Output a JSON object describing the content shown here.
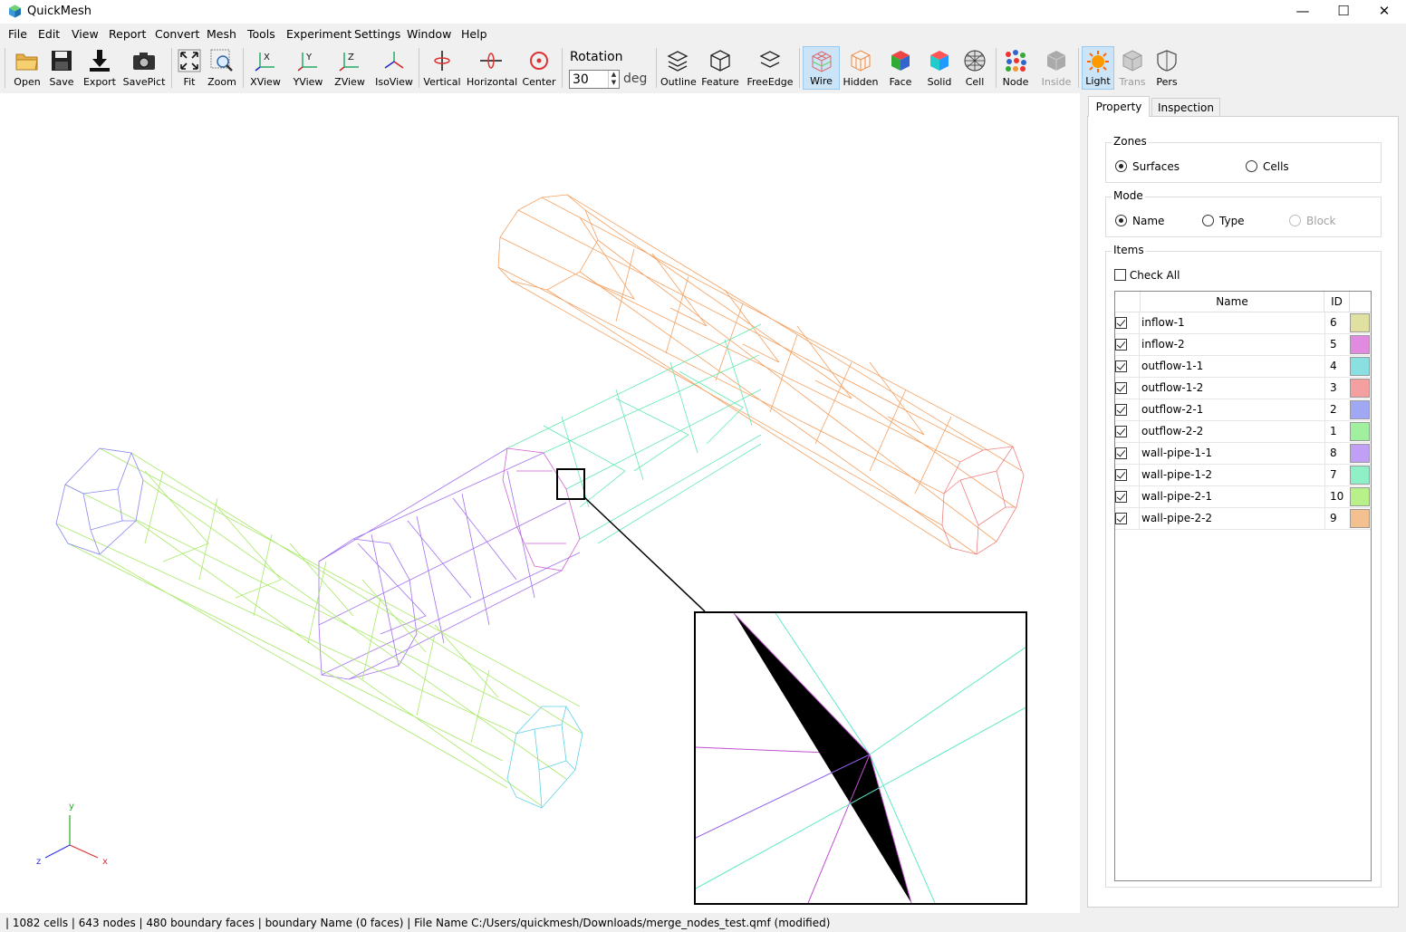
{
  "window": {
    "title": "QuickMesh",
    "minimize_glyph": "—",
    "maximize_glyph": "☐",
    "close_glyph": "✕"
  },
  "menu": [
    "File",
    "Edit",
    "View",
    "Report",
    "Convert",
    "Mesh",
    "Tools",
    "Experiment",
    "Settings",
    "Window",
    "Help"
  ],
  "toolbar": {
    "open": "Open",
    "save": "Save",
    "export": "Export",
    "savepict": "SavePict",
    "fit": "Fit",
    "zoom": "Zoom",
    "xview": "XView",
    "yview": "YView",
    "zview": "ZView",
    "isoview": "IsoView",
    "vertical": "Vertical",
    "horizontal": "Horizontal",
    "center": "Center",
    "rotation_label": "Rotation",
    "rotation_value": "30",
    "rotation_unit": "deg",
    "outline": "Outline",
    "feature": "Feature",
    "freeedge": "FreeEdge",
    "wire": "Wire",
    "hidden": "Hidden",
    "face": "Face",
    "solid": "Solid",
    "cell": "Cell",
    "node": "Node",
    "inside": "Inside",
    "light": "Light",
    "trans": "Trans",
    "pers": "Pers",
    "active": [
      "wire",
      "light"
    ],
    "disabled": [
      "inside",
      "trans"
    ]
  },
  "viewport": {
    "axis": {
      "x": "x",
      "y": "y",
      "z": "z"
    }
  },
  "panel": {
    "tabs": [
      "Property",
      "Inspection"
    ],
    "active_tab": "Property",
    "zones": {
      "title": "Zones",
      "options": [
        "Surfaces",
        "Cells"
      ],
      "selected": "Surfaces"
    },
    "mode": {
      "title": "Mode",
      "options": [
        "Name",
        "Type",
        "Block"
      ],
      "selected": "Name",
      "disabled": [
        "Block"
      ]
    },
    "items": {
      "title": "Items",
      "check_all": "Check All",
      "check_all_checked": false,
      "columns": [
        "Name",
        "ID"
      ],
      "rows": [
        {
          "name": "inflow-1",
          "id": "6",
          "color": "#e0e0a0",
          "checked": true
        },
        {
          "name": "inflow-2",
          "id": "5",
          "color": "#e08ae0",
          "checked": true
        },
        {
          "name": "outflow-1-1",
          "id": "4",
          "color": "#8ae0e0",
          "checked": true
        },
        {
          "name": "outflow-1-2",
          "id": "3",
          "color": "#f4a0a0",
          "checked": true
        },
        {
          "name": "outflow-2-1",
          "id": "2",
          "color": "#a0a8f4",
          "checked": true
        },
        {
          "name": "outflow-2-2",
          "id": "1",
          "color": "#a0f0a0",
          "checked": true
        },
        {
          "name": "wall-pipe-1-1",
          "id": "8",
          "color": "#c0a0f4",
          "checked": true
        },
        {
          "name": "wall-pipe-1-2",
          "id": "7",
          "color": "#8ff0c8",
          "checked": true
        },
        {
          "name": "wall-pipe-2-1",
          "id": "10",
          "color": "#b8f08a",
          "checked": true
        },
        {
          "name": "wall-pipe-2-2",
          "id": "9",
          "color": "#f4c090",
          "checked": true
        }
      ]
    }
  },
  "status": "| 1082 cells | 643 nodes | 480 boundary faces |  boundary Name  (0 faces) | File Name C:/Users/quickmesh/Downloads/merge_nodes_test.qmf (modified)"
}
